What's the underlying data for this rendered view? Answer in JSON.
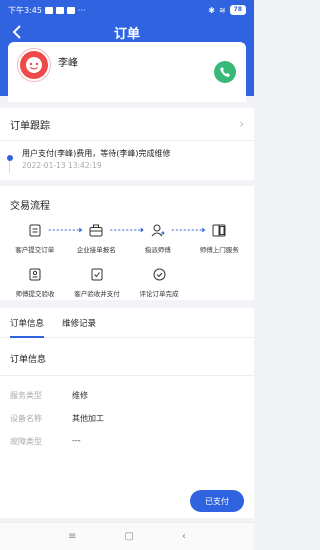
{
  "status_bar": {
    "time": "下午3:45",
    "battery": "78"
  },
  "header": {
    "title": "订单",
    "back_icon": "chevron-left-icon"
  },
  "profile": {
    "name": "李峰",
    "avatar_icon": "avatar-face-icon",
    "phone_icon": "phone-icon"
  },
  "tracking": {
    "title": "订单跟踪",
    "event_text": "用户支付(李峰)费用，等待(李峰)完成维修",
    "event_time": "2022-01-13 13:42:19"
  },
  "flow": {
    "title": "交易流程",
    "row1": [
      "客户提交订单",
      "企业接单报名",
      "指派师傅",
      "师傅上门服务"
    ],
    "row2": [
      "师傅提交验收",
      "客户验收并支付",
      "评论订单完成"
    ]
  },
  "tabs": [
    "订单信息",
    "维修记录"
  ],
  "order_info": {
    "title": "订单信息",
    "rows": [
      {
        "key": "服务类型",
        "value": "维修"
      },
      {
        "key": "设备名称",
        "value": "其他加工"
      },
      {
        "key": "故障类型",
        "value": "---"
      }
    ]
  },
  "paid_button": "已支付",
  "colors": {
    "primary": "#2f63e0",
    "call_green": "#38b97a",
    "avatar_red": "#ef4a4a"
  }
}
